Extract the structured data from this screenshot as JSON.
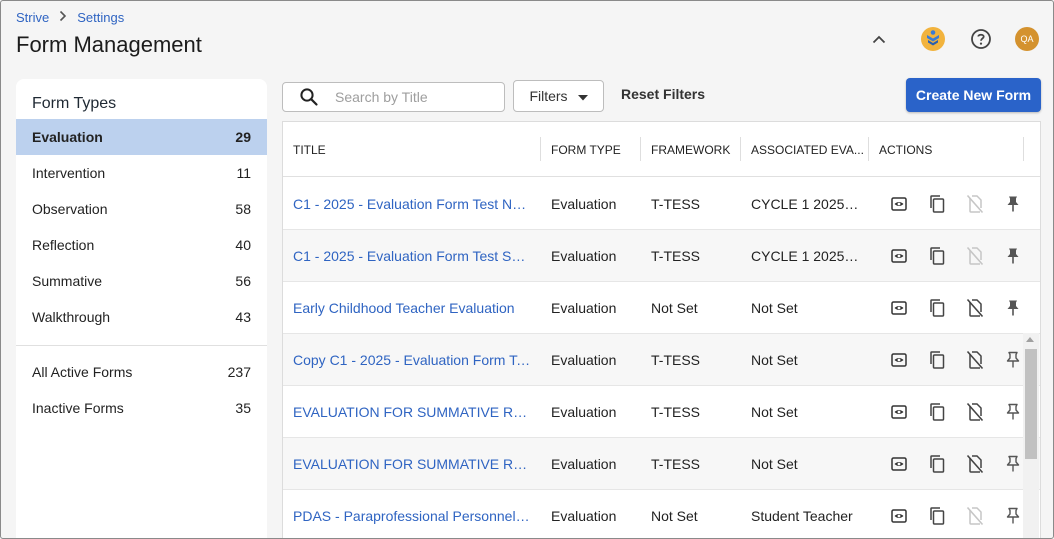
{
  "breadcrumb": {
    "root": "Strive",
    "current": "Settings"
  },
  "page_title": "Form Management",
  "header": {
    "avatar_initials": "QA"
  },
  "sidebar": {
    "title": "Form Types",
    "types": [
      {
        "label": "Evaluation",
        "count": "29",
        "active": true
      },
      {
        "label": "Intervention",
        "count": "11"
      },
      {
        "label": "Observation",
        "count": "58"
      },
      {
        "label": "Reflection",
        "count": "40"
      },
      {
        "label": "Summative",
        "count": "56"
      },
      {
        "label": "Walkthrough",
        "count": "43"
      }
    ],
    "other": [
      {
        "label": "All Active Forms",
        "count": "237"
      },
      {
        "label": "Inactive Forms",
        "count": "35"
      }
    ]
  },
  "toolbar": {
    "search_placeholder": "Search by Title",
    "filters_label": "Filters",
    "reset_label": "Reset Filters",
    "create_label": "Create New Form"
  },
  "table": {
    "columns": [
      "TITLE",
      "FORM TYPE",
      "FRAMEWORK",
      "ASSOCIATED EVA...",
      "ACTIONS"
    ],
    "rows": [
      {
        "title": "C1 - 2025 - Evaluation Form Test NO...",
        "form_type": "Evaluation",
        "framework": "T-TESS",
        "associated": "CYCLE 1 2025 -...",
        "unlink_disabled": true,
        "pinned": true
      },
      {
        "title": "C1 - 2025 - Evaluation Form Test SC...",
        "form_type": "Evaluation",
        "framework": "T-TESS",
        "associated": "CYCLE 1 2025 -...",
        "unlink_disabled": true,
        "pinned": true
      },
      {
        "title": "Early Childhood Teacher Evaluation",
        "form_type": "Evaluation",
        "framework": "Not Set",
        "associated": "Not Set",
        "unlink_disabled": false,
        "pinned": true
      },
      {
        "title": "Copy C1 - 2025 - Evaluation Form Te...",
        "form_type": "Evaluation",
        "framework": "T-TESS",
        "associated": "Not Set",
        "unlink_disabled": false,
        "pinned": false
      },
      {
        "title": "EVALUATION FOR SUMMATIVE REFI...",
        "form_type": "Evaluation",
        "framework": "T-TESS",
        "associated": "Not Set",
        "unlink_disabled": false,
        "pinned": false
      },
      {
        "title": "EVALUATION FOR SUMMATIVE REFI...",
        "form_type": "Evaluation",
        "framework": "T-TESS",
        "associated": "Not Set",
        "unlink_disabled": false,
        "pinned": false
      },
      {
        "title": "PDAS - Paraprofessional Personnel ...",
        "form_type": "Evaluation",
        "framework": "Not Set",
        "associated": "Student Teacher",
        "unlink_disabled": true,
        "pinned": false
      }
    ]
  },
  "colors": {
    "accent": "#2a63c9",
    "link": "#2f64c2",
    "active_row": "#bcd1ee",
    "avatar": "#d4922e"
  }
}
